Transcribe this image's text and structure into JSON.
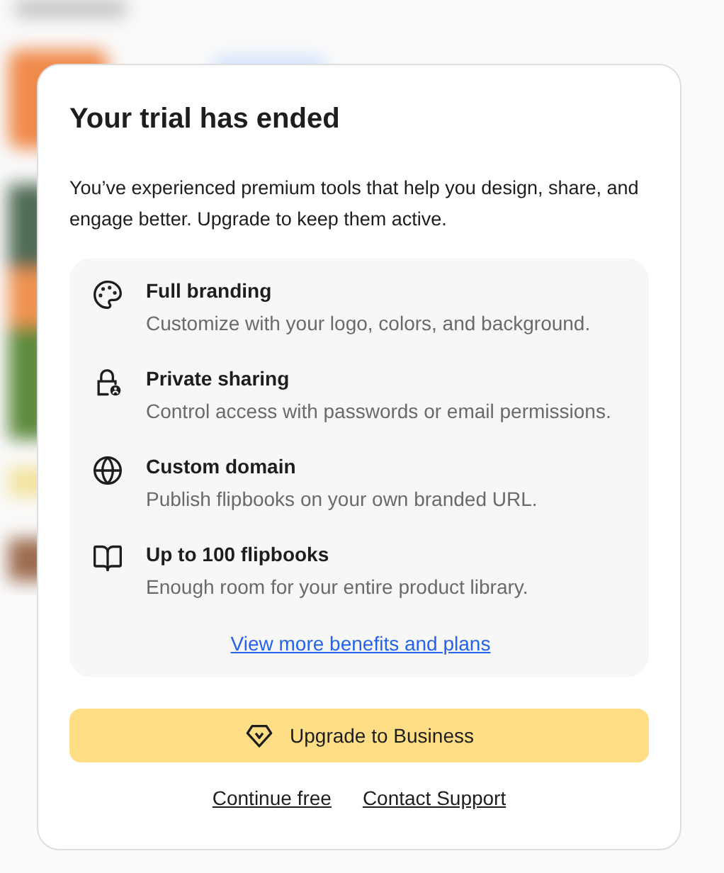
{
  "dialog": {
    "title": "Your trial has ended",
    "message": "You’ve experienced premium tools that help you design, share, and engage better. Upgrade to keep them active.",
    "benefits": [
      {
        "title": "Full branding",
        "description": "Customize with your logo, colors, and background."
      },
      {
        "title": "Private sharing",
        "description": "Control access with passwords or email permissions."
      },
      {
        "title": "Custom domain",
        "description": "Publish flipbooks on your own branded URL."
      },
      {
        "title": "Up to 100 flipbooks",
        "description": "Enough room for your entire product library."
      }
    ],
    "benefits_link": "View more benefits and plans",
    "primary_button": "Upgrade to Business",
    "links": [
      "Continue free",
      "Contact Support"
    ]
  }
}
